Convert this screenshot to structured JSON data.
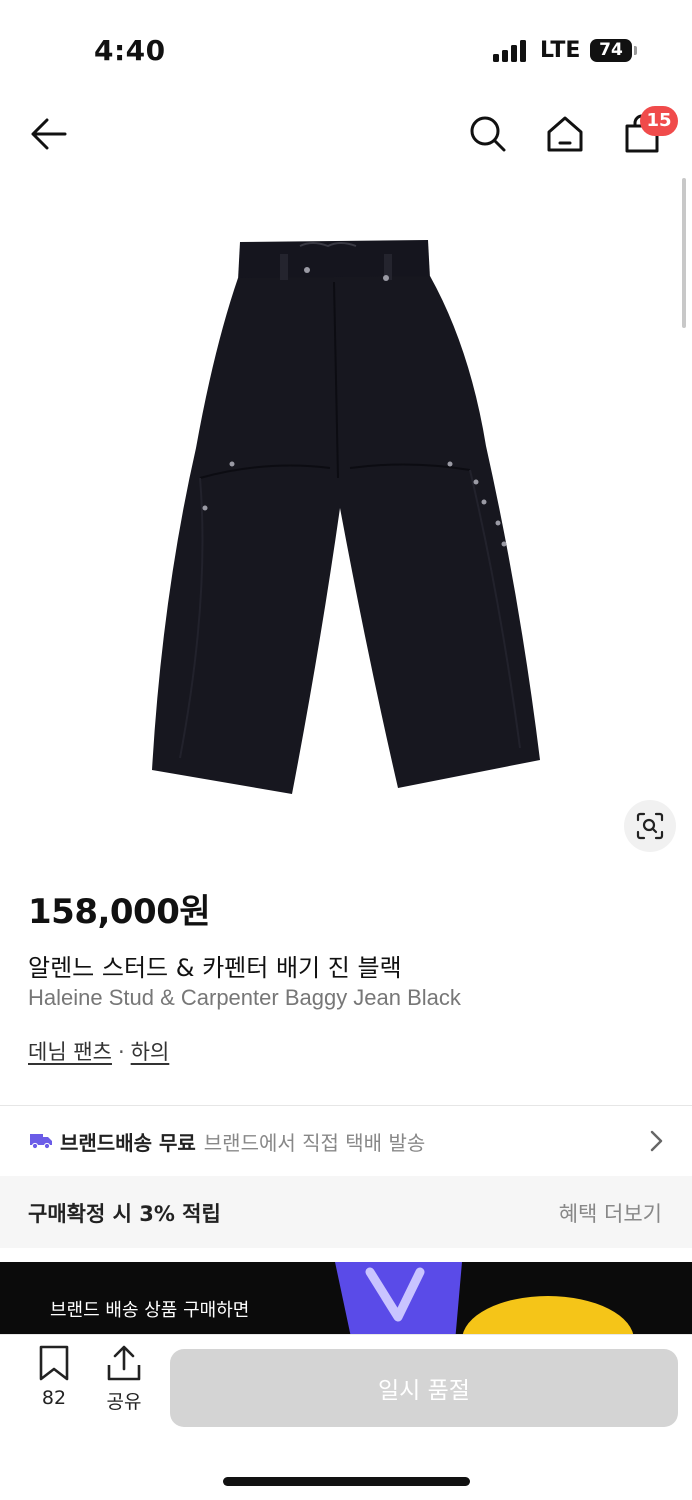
{
  "status_bar": {
    "time": "4:40",
    "network": "LTE",
    "battery": "74"
  },
  "nav": {
    "back_icon": "arrow-left-icon",
    "search_icon": "search-icon",
    "home_icon": "home-icon",
    "cart_icon": "shopping-bag-icon",
    "cart_count": "15"
  },
  "product": {
    "image_alt": "black baggy jeans",
    "price": "158,000원",
    "name_ko": "알렌느 스터드 & 카펜터 배기 진 블랙",
    "name_en": "Haleine Stud & Carpenter Baggy Jean Black",
    "categories": [
      "데님 팬츠",
      "하의"
    ],
    "category_separator": "·"
  },
  "delivery": {
    "main": "브랜드배송 무료",
    "sub": "브랜드에서 직접 택배 발송"
  },
  "benefit": {
    "label": "구매확정 시 3% 적립",
    "more": "혜택 더보기"
  },
  "banner": {
    "text": "브랜드 배송 상품 구매하면"
  },
  "bottom_bar": {
    "bookmark_count": "82",
    "share_label": "공유",
    "action_label": "일시 품절"
  },
  "colors": {
    "badge": "#f04b4b",
    "truck": "#6b5ce7",
    "disabled_button": "#d4d4d4"
  }
}
